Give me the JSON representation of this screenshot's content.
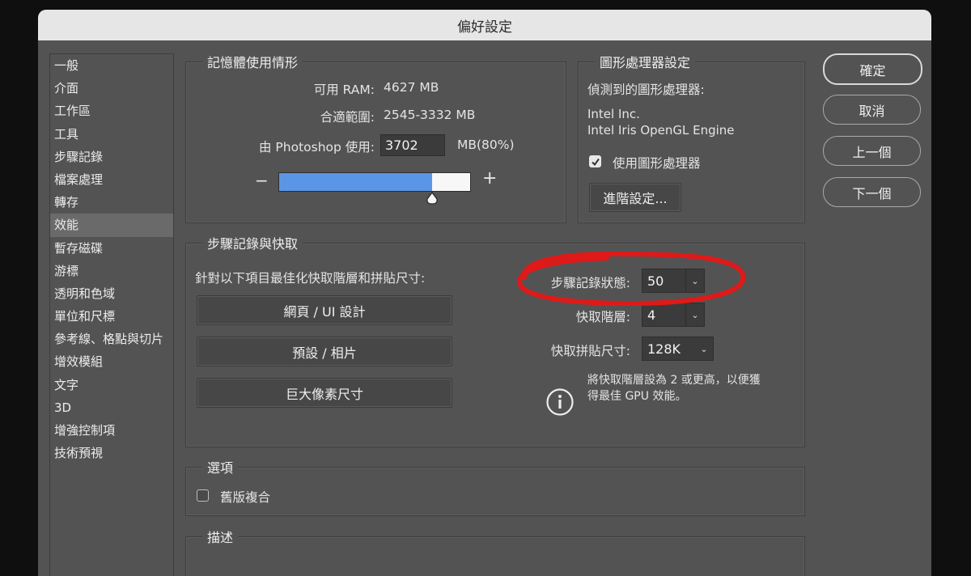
{
  "window": {
    "title": "偏好設定"
  },
  "sidebar": {
    "items": [
      {
        "label": "一般"
      },
      {
        "label": "介面"
      },
      {
        "label": "工作區"
      },
      {
        "label": "工具"
      },
      {
        "label": "步驟記錄"
      },
      {
        "label": "檔案處理"
      },
      {
        "label": "轉存"
      },
      {
        "label": "效能"
      },
      {
        "label": "暫存磁碟"
      },
      {
        "label": "游標"
      },
      {
        "label": "透明和色域"
      },
      {
        "label": "單位和尺標"
      },
      {
        "label": "參考線、格點與切片"
      },
      {
        "label": "增效模組"
      },
      {
        "label": "文字"
      },
      {
        "label": "3D"
      },
      {
        "label": "增強控制項"
      },
      {
        "label": "技術預視"
      }
    ],
    "selected": "效能"
  },
  "memory": {
    "title": "記憶體使用情形",
    "available_label": "可用 RAM:",
    "available_value": "4627 MB",
    "range_label": "合適範圍:",
    "range_value": "2545-3332 MB",
    "use_label": "由 Photoshop 使用:",
    "use_value": "3702",
    "use_unit": "MB(80%)",
    "minus": "−",
    "plus": "+",
    "slider_fraction": 0.8,
    "fill_color": "#5b95e6"
  },
  "gpu": {
    "title": "圖形處理器設定",
    "detected_label": "偵測到的圖形處理器:",
    "vendor": "Intel Inc.",
    "renderer": "Intel Iris OpenGL Engine",
    "use_gpu_label": "使用圖形處理器",
    "use_gpu_checked": true,
    "advanced_button": "進階設定..."
  },
  "history": {
    "title": "步驟記錄與快取",
    "optimize_label": "針對以下項目最佳化快取階層和拼貼尺寸:",
    "preset_web": "網頁 / UI 設計",
    "preset_default": "預設 / 相片",
    "preset_huge": "巨大像素尺寸",
    "states_label": "步驟記錄狀態:",
    "states_value": "50",
    "levels_label": "快取階層:",
    "levels_value": "4",
    "tile_label": "快取拼貼尺寸:",
    "tile_value": "128K",
    "info_line1": "將快取階層設為 2 或更高，以便獲",
    "info_line2": "得最佳 GPU 效能。",
    "highlight_color": "#e01919"
  },
  "options": {
    "title": "選項",
    "legacy_label": "舊版複合",
    "legacy_checked": false
  },
  "description": {
    "title": "描述"
  },
  "buttons": {
    "ok": "確定",
    "cancel": "取消",
    "prev": "上一個",
    "next": "下一個"
  }
}
